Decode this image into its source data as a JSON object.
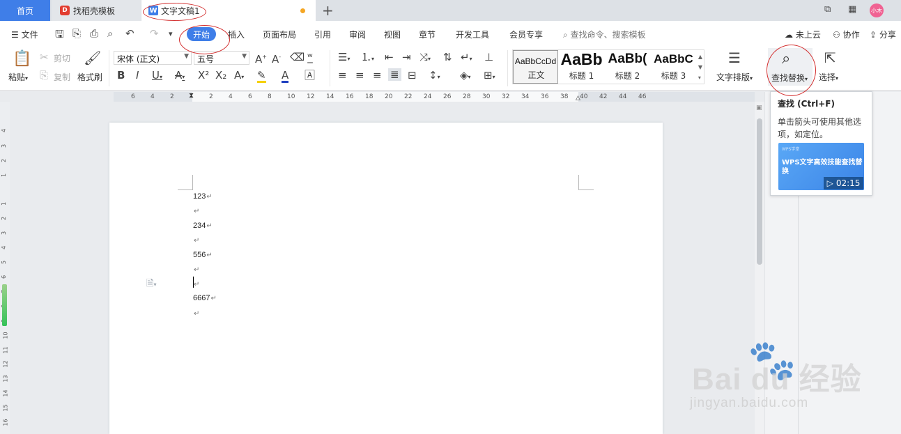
{
  "tabs": {
    "home": "首页",
    "docer": "找稻壳模板",
    "document": "文字文稿1"
  },
  "menu": {
    "file": "文件",
    "start": "开始",
    "insert": "插入",
    "layout": "页面布局",
    "reference": "引用",
    "review": "审阅",
    "view": "视图",
    "chapter": "章节",
    "developer": "开发工具",
    "member": "会员专享",
    "search_placeholder": "查找命令、搜索模板",
    "cloud": "未上云",
    "collab": "协作",
    "share": "分享"
  },
  "ribbon": {
    "paste": "粘贴",
    "cut": "剪切",
    "copy": "复制",
    "format_painter": "格式刷",
    "font_name": "宋体 (正文)",
    "font_size": "五号",
    "styles": [
      {
        "sample": "AaBbCcDd",
        "name": "正文"
      },
      {
        "sample": "AaBb",
        "name": "标题 1"
      },
      {
        "sample": "AaBb(",
        "name": "标题 2"
      },
      {
        "sample": "AaBbC",
        "name": "标题 3"
      }
    ],
    "text_layout": "文字排版",
    "find_replace": "查找替换",
    "select": "选择"
  },
  "ruler": {
    "h_ticks": [
      "6",
      "4",
      "2",
      "2",
      "4",
      "6",
      "8",
      "10",
      "12",
      "14",
      "16",
      "18",
      "20",
      "22",
      "24",
      "26",
      "28",
      "30",
      "32",
      "34",
      "36",
      "38",
      "40",
      "42",
      "44",
      "46"
    ],
    "v_ticks": [
      "4",
      "3",
      "2",
      "1",
      "1",
      "2",
      "3",
      "4",
      "5",
      "6",
      "7",
      "8",
      "9",
      "10",
      "11",
      "12",
      "13",
      "14",
      "15",
      "16"
    ]
  },
  "document": {
    "paragraphs": [
      "123",
      "",
      "234",
      "",
      "556",
      "",
      "",
      "6667",
      ""
    ],
    "para_mark": "↵"
  },
  "tooltip": {
    "title": "查找 (Ctrl+F)",
    "description": "单击箭头可使用其他选项，如定位。",
    "video_brand": "WPS学堂",
    "video_title": "WPS文字高效技能查找替换",
    "video_duration": "02:15"
  },
  "avatar": "小木",
  "watermark": {
    "main": "Bai du 经验",
    "sub": "jingyan.baidu.com"
  },
  "colors": {
    "accent": "#3f7ee8",
    "annotation": "#d32f2f",
    "highlight": "#f5d000",
    "font_color": "#1f3fbf"
  }
}
